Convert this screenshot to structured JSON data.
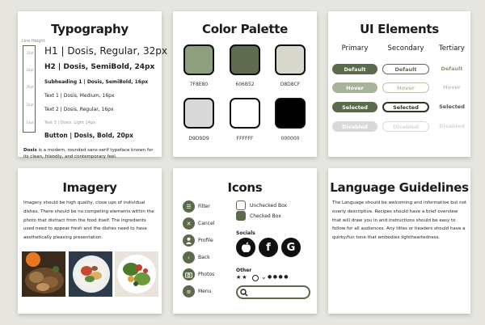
{
  "typography": {
    "title": "Typography",
    "line_height_label": "Line Height",
    "ticks": [
      "32pt",
      "24pt",
      "20pt",
      "16pt",
      "14pt"
    ],
    "h1": "H1 | Dosis, Regular, 32px",
    "h2": "H2 | Dosis, SemiBold, 24px",
    "subheading": "Subheading 1 | Dosis, SemiBold, 16px",
    "text1": "Text 1 | Dosis, Medium, 16px",
    "text2": "Text 2 | Dosis, Regular, 16px",
    "text3": "Text 3 | Dosis, Light 14px",
    "button": "Button | Dosis, Bold, 20px",
    "desc_bold": "Dosis",
    "desc_rest": " is a modern, rounded sans-serif typeface known for its clean, friendly, and contemporary feel."
  },
  "palette": {
    "title": "Color Palette",
    "swatches": [
      {
        "hex": "7F8E80",
        "color": "#8fa080"
      },
      {
        "hex": "606B52",
        "color": "#5f6a50"
      },
      {
        "hex": "D8D8CF",
        "color": "#d8d8cf"
      },
      {
        "hex": "D9D9D9",
        "color": "#d9d9d9"
      },
      {
        "hex": "FFFFFF",
        "color": "#ffffff"
      },
      {
        "hex": "000000",
        "color": "#000000"
      }
    ]
  },
  "ui_elements": {
    "title": "UI Elements",
    "columns": [
      "Primary",
      "Secondary",
      "Tertiary"
    ],
    "states": [
      "Default",
      "Hover",
      "Selected",
      "Disabled"
    ]
  },
  "imagery": {
    "title": "Imagery",
    "text": "Imagery should be high quality, close ups of individual dishes. There should be no competing elements within the photo that distract from the food itself. The ingredients used need to appear fresh and the dishes need to have aesthetically pleasing presentation."
  },
  "icons": {
    "title": "Icons",
    "items": [
      "Filter",
      "Cancel",
      "Profile",
      "Back",
      "Photos",
      "Menu"
    ],
    "unchecked": "Unchecked Box",
    "checked": "Checked Box",
    "socials_label": "Socials",
    "other_label": "Other"
  },
  "language": {
    "title": "Language Guidelines",
    "text": "The Language should be welcoming and informative but not overly descriptive. Recipes should have a brief overview that will draw you in and instructions should be easy to follow for all audiences. Any titles or headers should have a quirky/fun tone that embodies lightheartedness."
  },
  "colors": {
    "accent": "#5c6a4c",
    "accent_light": "#a8b49a",
    "disabled": "#d9d9d9"
  }
}
